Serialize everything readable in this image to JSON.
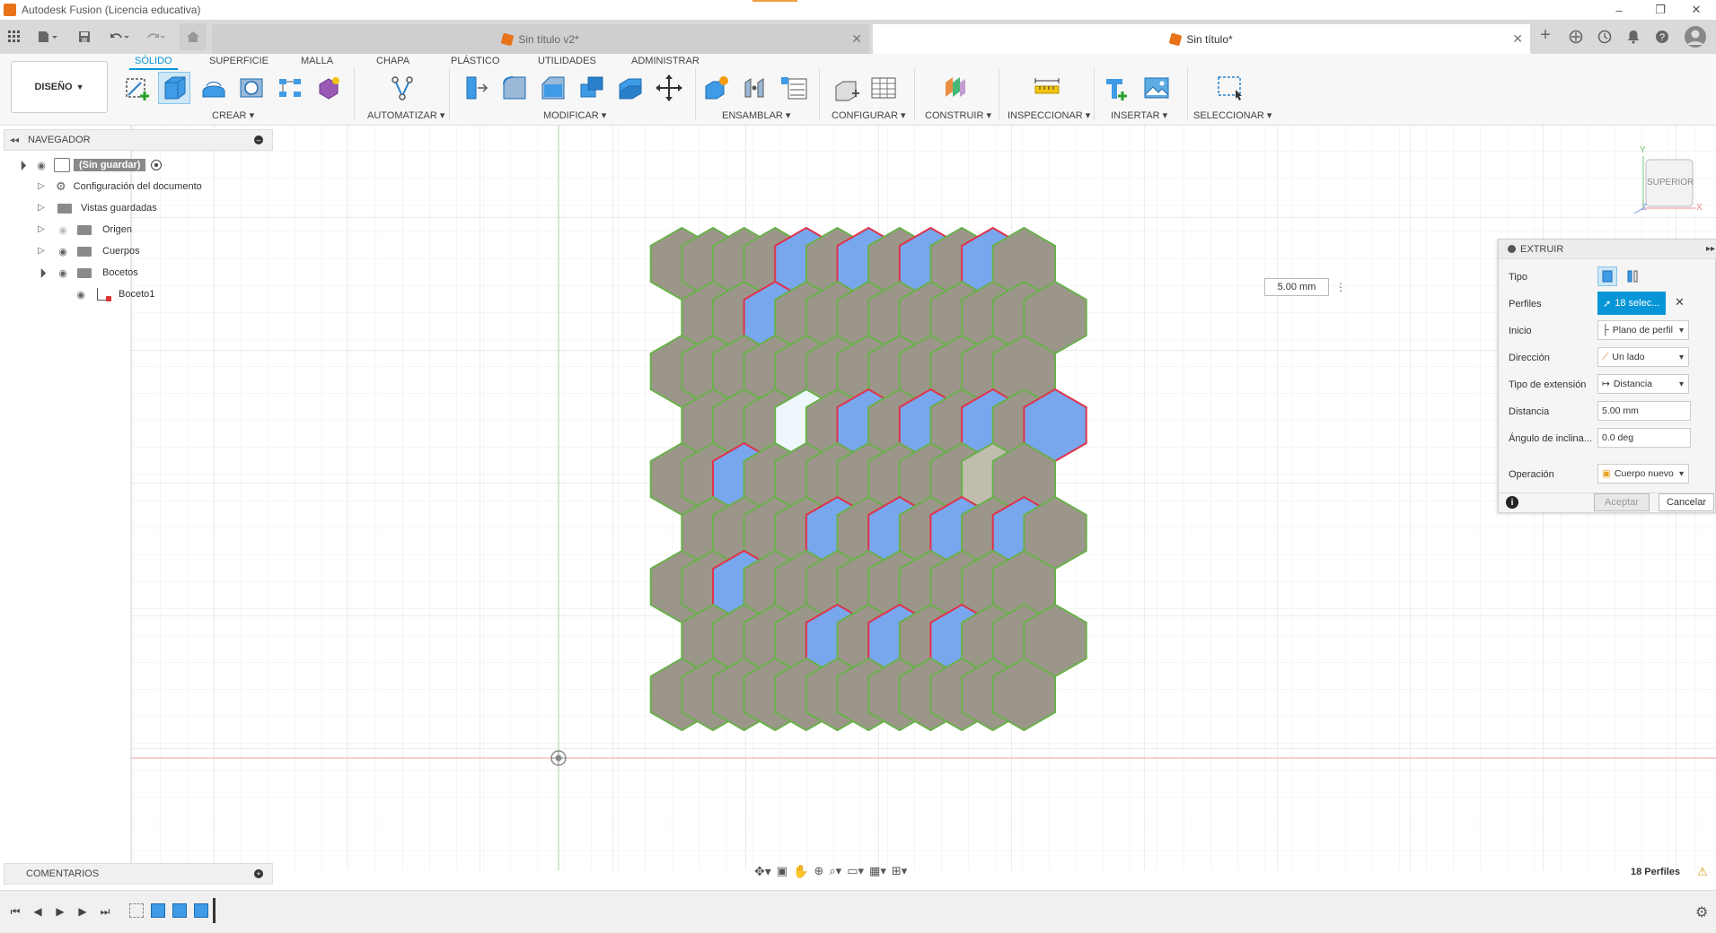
{
  "window": {
    "title": "Autodesk Fusion (Licencia educativa)",
    "controls": [
      "–",
      "❐",
      "✕"
    ]
  },
  "tabs": {
    "doc1": "Sin título v2*",
    "doc2": "Sin título*"
  },
  "ribbon": {
    "design_label": "DISEÑO",
    "tabs": [
      "SÓLIDO",
      "SUPERFICIE",
      "MALLA",
      "CHAPA",
      "PLÁSTICO",
      "UTILIDADES",
      "ADMINISTRAR"
    ],
    "groups": [
      "CREAR",
      "AUTOMATIZAR",
      "MODIFICAR",
      "ENSAMBLAR",
      "CONFIGURAR",
      "CONSTRUIR",
      "INSPECCIONAR",
      "INSERTAR",
      "SELECCIONAR"
    ]
  },
  "navigator": {
    "title": "NAVEGADOR",
    "root": "(Sin guardar)",
    "items": [
      "Configuración del documento",
      "Vistas guardadas",
      "Origen",
      "Cuerpos",
      "Bocetos",
      "Boceto1"
    ]
  },
  "comments": {
    "title": "COMENTARIOS"
  },
  "viewcube": {
    "face": "SUPERIOR",
    "axis_y": "Y",
    "axis_x": "X",
    "axis_z": "Z"
  },
  "manipulator": {
    "distance": "5.00 mm"
  },
  "extrude": {
    "title": "EXTRUIR",
    "labels": {
      "tipo": "Tipo",
      "perfiles": "Perfiles",
      "inicio": "Inicio",
      "direccion": "Dirección",
      "tipo_extension": "Tipo de extensión",
      "distancia": "Distancia",
      "angulo": "Ángulo de inclina...",
      "operacion": "Operación"
    },
    "values": {
      "perfiles": "18 selec...",
      "inicio": "Plano de perfil",
      "direccion": "Un lado",
      "tipo_extension": "Distancia",
      "distancia": "5.00 mm",
      "angulo": "0.0 deg",
      "operacion": "Cuerpo nuevo"
    },
    "ok": "Aceptar",
    "cancel": "Cancelar"
  },
  "status": {
    "profiles": "18 Perfiles"
  },
  "colors": {
    "accent": "#0696d7",
    "tile_gray": "#9c968a",
    "tile_blue": "#78a7ee",
    "edge_green": "#6ab04c",
    "edge_red": "#e0334a",
    "tile_light": "#eef7fb",
    "tile_hover": "#c0bcae"
  }
}
